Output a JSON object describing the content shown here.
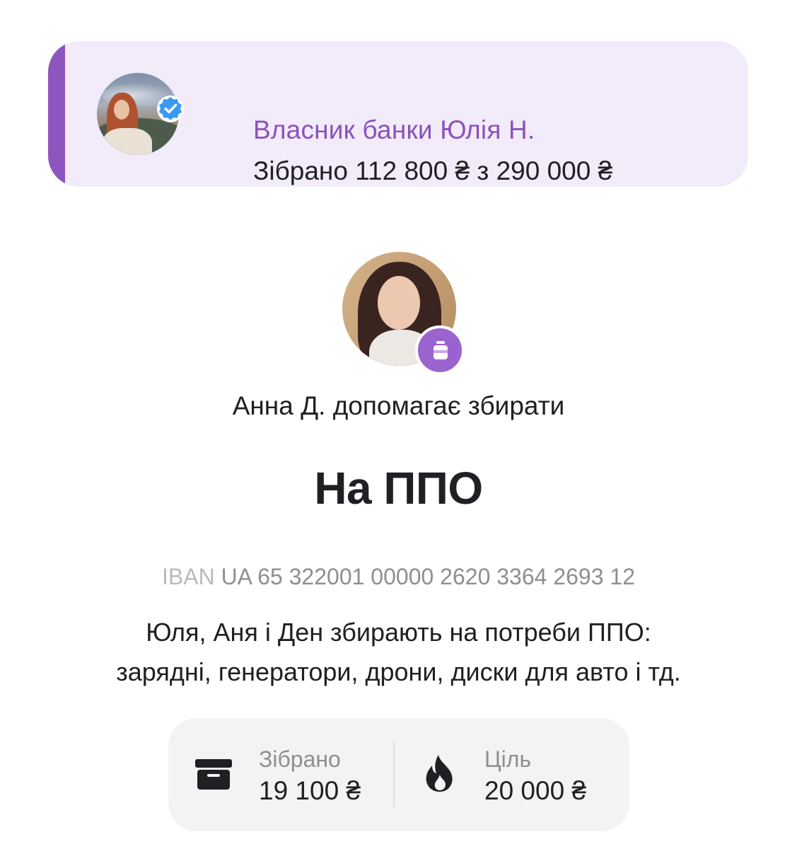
{
  "owner_card": {
    "name": "Власник банки Юлія Н.",
    "collected_text": "Зібрано 112 800 ₴ з 290 000 ₴",
    "accent_color": "#8e55bf",
    "background_color": "#f2ebfa",
    "badge_icon": "verified-check-icon",
    "quote_icon": "quote-icon"
  },
  "helper": {
    "text": "Анна Д. допомагає збирати",
    "badge_icon": "jar-icon",
    "badge_color": "#9a63cf"
  },
  "jar": {
    "title": "На ППО",
    "iban_label": "IBAN",
    "iban_value": "UA 65 322001 00000 2620 3364 2693 12",
    "description_lines": [
      "Юля, Аня і Ден збирають на потреби ППО:",
      "зарядні, генератори, дрони, диски для авто і тд."
    ]
  },
  "stats": {
    "collected_label": "Зібрано",
    "collected_value": "19 100 ₴",
    "collected_icon": "archive-box-icon",
    "goal_label": "Ціль",
    "goal_value": "20 000 ₴",
    "goal_icon": "fire-icon"
  }
}
